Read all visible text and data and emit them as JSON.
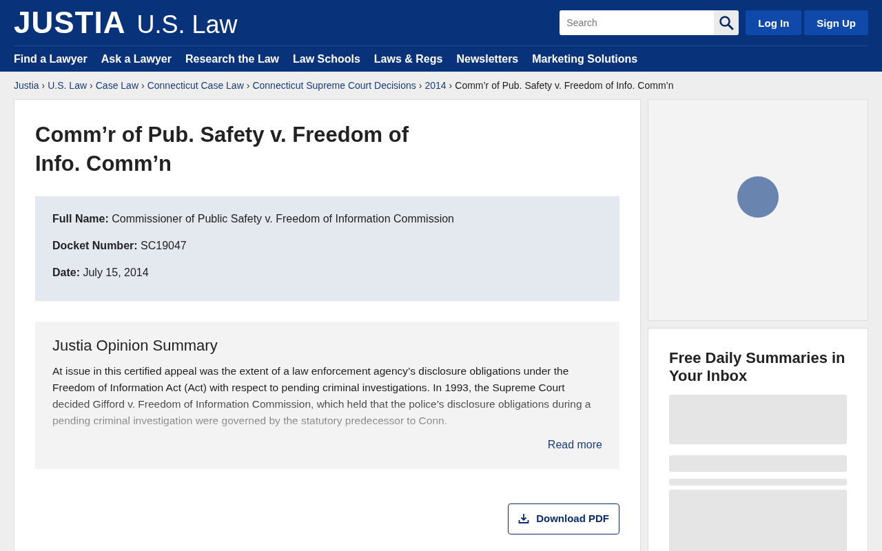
{
  "header": {
    "logo": "JUSTIA",
    "section": "U.S. Law",
    "search": {
      "placeholder": "Search"
    },
    "buttons": [
      "Log In",
      "Sign Up"
    ]
  },
  "nav": [
    "Find a Lawyer",
    "Ask a Lawyer",
    "Research the Law",
    "Law Schools",
    "Laws & Regs",
    "Newsletters",
    "Marketing Solutions"
  ],
  "breadcrumbs": [
    {
      "label": "Justia",
      "link": true,
      "separator": "›"
    },
    {
      "label": "U.S. Law",
      "link": true,
      "separator": "›"
    },
    {
      "label": "Case Law",
      "link": true,
      "separator": "›"
    },
    {
      "label": "Connecticut Case Law",
      "link": true,
      "separator": "›"
    },
    {
      "label": "Connecticut Supreme Court Decisions",
      "link": true,
      "separator": "›"
    },
    {
      "label": "2014",
      "link": true,
      "separator": "›"
    },
    {
      "label": "Comm’r of Pub. Safety v. Freedom of Info. Comm’n",
      "link": false
    }
  ],
  "case": {
    "title": "Comm’r of Pub. Safety v. Freedom of Info. Comm’n",
    "details": [
      {
        "label": "Full Name:",
        "value": "Commissioner of Public Safety v. Freedom of Information Commission"
      },
      {
        "label": "Docket Number:",
        "value": "SC19047"
      },
      {
        "label": "Date:",
        "value": "July 15, 2014"
      }
    ]
  },
  "summary": {
    "title": "Justia Opinion Summary",
    "text": "At issue in this certified appeal was the extent of a law enforcement agency’s disclosure obligations under the Freedom of Information Act (Act) with respect to pending criminal investigations. In 1993, the Supreme Court decided Gifford v. Freedom of Information Commission, which held that the police’s disclosure obligations during a pending criminal investigation were governed by the statutory predecessor to Conn.",
    "read_more": "Read more"
  },
  "download": "Download PDF",
  "newsletter": {
    "title": "Free Daily Summaries in Your Inbox"
  }
}
